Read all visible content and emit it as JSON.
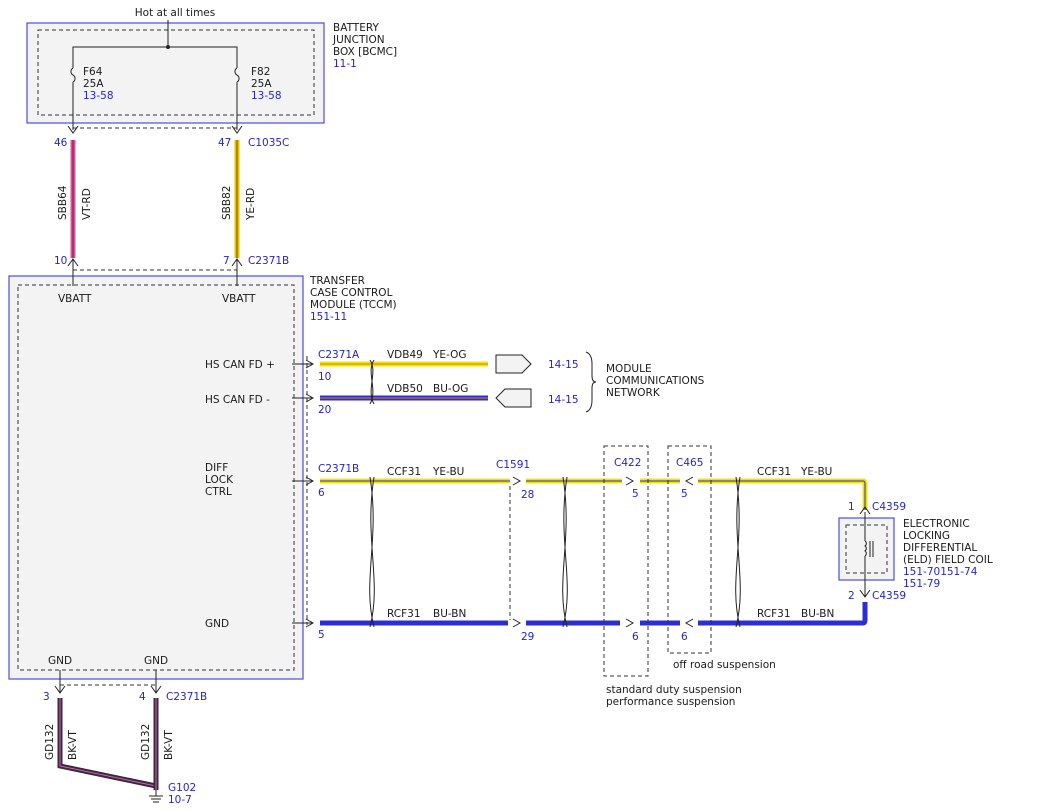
{
  "bjb": {
    "label1": "BATTERY",
    "label2": "JUNCTION",
    "label3": "BOX [BCMC]",
    "ref": "11-1",
    "hot": "Hot at all times",
    "f64": {
      "name": "F64",
      "amp": "25A",
      "ref": "13-58"
    },
    "f82": {
      "name": "F82",
      "amp": "25A",
      "ref": "13-58"
    },
    "pin_left": "46",
    "pin_right": "47",
    "connector": "C1035C"
  },
  "wires_top": {
    "left": {
      "circuit": "SBB64",
      "color": "VT-RD"
    },
    "right": {
      "circuit": "SBB82",
      "color": "YE-RD"
    }
  },
  "tccm": {
    "label1": "TRANSFER",
    "label2": "CASE CONTROL",
    "label3": "MODULE (TCCM)",
    "ref": "151-11",
    "pin_left": "10",
    "pin_right": "7",
    "connector": "C2371B",
    "vbatt1": "VBATT",
    "vbatt2": "VBATT",
    "hs_plus": "HS CAN FD +",
    "hs_minus": "HS CAN FD -",
    "diff1": "DIFF",
    "diff2": "LOCK",
    "diff3": "CTRL",
    "gnd_sig": "GND",
    "gnd1": "GND",
    "gnd2": "GND"
  },
  "can": {
    "connector": "C2371A",
    "pin_plus": "10",
    "pin_minus": "20",
    "w1": {
      "circuit": "VDB49",
      "color": "YE-OG",
      "ref": "14-15"
    },
    "w2": {
      "circuit": "VDB50",
      "color": "BU-OG",
      "ref": "14-15"
    },
    "net1": "MODULE",
    "net2": "COMMUNICATIONS",
    "net3": "NETWORK"
  },
  "diff_line": {
    "connector": "C2371B",
    "pin": "6",
    "circuit": "CCF31",
    "color": "YE-BU",
    "c1591": "C1591",
    "pin28": "28",
    "c422": "C422",
    "pin422": "5",
    "c465": "C465",
    "pin465": "5",
    "circuit2": "CCF31",
    "color2": "YE-BU"
  },
  "gnd_line": {
    "pin": "5",
    "circuit": "RCF31",
    "color": "BU-BN",
    "pin29": "29",
    "pin422": "6",
    "pin465": "6",
    "circuit2": "RCF31",
    "color2": "BU-BN"
  },
  "eld": {
    "pin1": "1",
    "conn1": "C4359",
    "pin2": "2",
    "conn2": "C4359",
    "label1": "ELECTRONIC",
    "label2": "LOCKING",
    "label3": "DIFFERENTIAL",
    "label4": "(ELD) FIELD COIL",
    "ref1": "151-70151-74",
    "ref2": "151-79"
  },
  "notes": {
    "offroad": "off road suspension",
    "std1": "standard duty suspension",
    "std2": "performance suspension"
  },
  "ground": {
    "pin3": "3",
    "pin4": "4",
    "connector": "C2371B",
    "w1": {
      "circuit": "GD132",
      "color": "BK-VT"
    },
    "w2": {
      "circuit": "GD132",
      "color": "BK-VT"
    },
    "g102": "G102",
    "ref": "10-7"
  },
  "colors": {
    "violet_red": "#e0509a",
    "yellow": "#e7c000",
    "yellow_light": "#f2e400",
    "blue": "#2d2dd6",
    "blue_link": "#2424d0",
    "black_violet": "#3a2a3a"
  }
}
